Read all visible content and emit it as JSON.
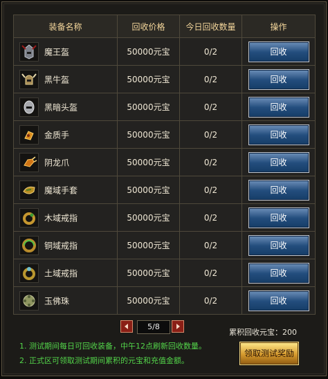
{
  "table": {
    "headers": [
      "装备名称",
      "回收价格",
      "今日回收数量",
      "操作"
    ],
    "rows": [
      {
        "name": "魔王盔",
        "price": "50000元宝",
        "count": "0/2",
        "button": "回收",
        "icon": "demon-helmet-icon"
      },
      {
        "name": "黑牛盔",
        "price": "50000元宝",
        "count": "0/2",
        "button": "回收",
        "icon": "bull-helmet-icon"
      },
      {
        "name": "黑暗头盔",
        "price": "50000元宝",
        "count": "0/2",
        "button": "回收",
        "icon": "dark-helmet-icon"
      },
      {
        "name": "金质手",
        "price": "50000元宝",
        "count": "0/2",
        "button": "回收",
        "icon": "gold-gauntlet-icon"
      },
      {
        "name": "阴龙爪",
        "price": "50000元宝",
        "count": "0/2",
        "button": "回收",
        "icon": "dragon-claw-icon"
      },
      {
        "name": "魔域手套",
        "price": "50000元宝",
        "count": "0/2",
        "button": "回收",
        "icon": "demon-glove-icon"
      },
      {
        "name": "木域戒指",
        "price": "50000元宝",
        "count": "0/2",
        "button": "回收",
        "icon": "wood-ring-icon"
      },
      {
        "name": "铜域戒指",
        "price": "50000元宝",
        "count": "0/2",
        "button": "回收",
        "icon": "bronze-ring-icon"
      },
      {
        "name": "土域戒指",
        "price": "50000元宝",
        "count": "0/2",
        "button": "回收",
        "icon": "earth-ring-icon"
      },
      {
        "name": "玉佛珠",
        "price": "50000元宝",
        "count": "0/2",
        "button": "回收",
        "icon": "jade-bead-icon"
      }
    ]
  },
  "pager": {
    "label": "5/8",
    "prev_icon": "left-arrow-icon",
    "next_icon": "right-arrow-icon"
  },
  "total_label": "累积回收元宝：200",
  "notes": [
    "1. 测试期间每日可回收装备，中午12点刷新回收数量。",
    "2. 正式区可领取测试期间累积的元宝和充值金额。"
  ],
  "claim_button": "领取测试奖励",
  "colors": {
    "header_text": "#f5d79c",
    "note_text": "#53d44a",
    "button_blue": "#234d7d",
    "claim_gold": "#d59a2d"
  }
}
